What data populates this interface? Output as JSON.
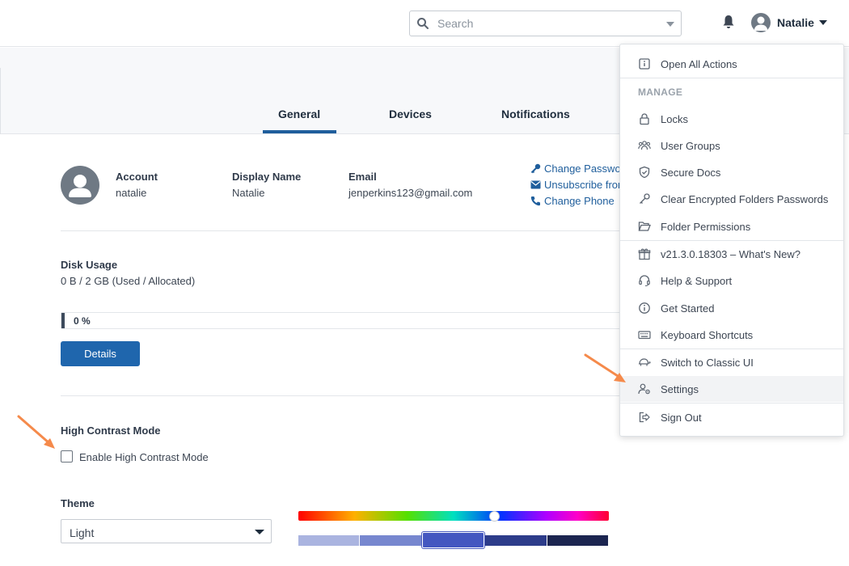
{
  "header": {
    "search": {
      "placeholder": "Search"
    },
    "user": {
      "name": "Natalie"
    }
  },
  "tabs": [
    {
      "label": "General",
      "active": true
    },
    {
      "label": "Devices",
      "active": false
    },
    {
      "label": "Notifications",
      "active": false
    }
  ],
  "account": {
    "account_label": "Account",
    "account_value": "natalie",
    "display_name_label": "Display Name",
    "display_name_value": "Natalie",
    "email_label": "Email",
    "email_value": "jenperkins123@gmail.com",
    "links": [
      "Change Password",
      "Unsubscribe from",
      "Change Phone"
    ]
  },
  "disk": {
    "label": "Disk Usage",
    "value": "0 B / 2 GB (Used / Allocated)",
    "progress_text": "0 %",
    "progress_fraction": 0,
    "details_button": "Details"
  },
  "contrast": {
    "title": "High Contrast Mode",
    "checkbox_label": "Enable High Contrast Mode",
    "checked": false
  },
  "theme": {
    "label": "Theme",
    "selected": "Light",
    "shade_colors": [
      "#aab4e0",
      "#7787cf",
      "#4457c0",
      "#2d3c8a",
      "#1c2550"
    ],
    "selected_shade_index": 2
  },
  "menu": {
    "open_all_actions": "Open All Actions",
    "manage_header": "MANAGE",
    "locks": "Locks",
    "user_groups": "User Groups",
    "secure_docs": "Secure Docs",
    "clear_encrypted": "Clear Encrypted Folders Passwords",
    "folder_permissions": "Folder Permissions",
    "version": "v21.3.0.18303 – What's New?",
    "help_support": "Help & Support",
    "get_started": "Get Started",
    "keyboard_shortcuts": "Keyboard Shortcuts",
    "switch_classic": "Switch to Classic UI",
    "settings": "Settings",
    "sign_out": "Sign Out"
  },
  "colors": {
    "accent": "#1f66ad",
    "annotation_arrow": "#f58a4b"
  }
}
